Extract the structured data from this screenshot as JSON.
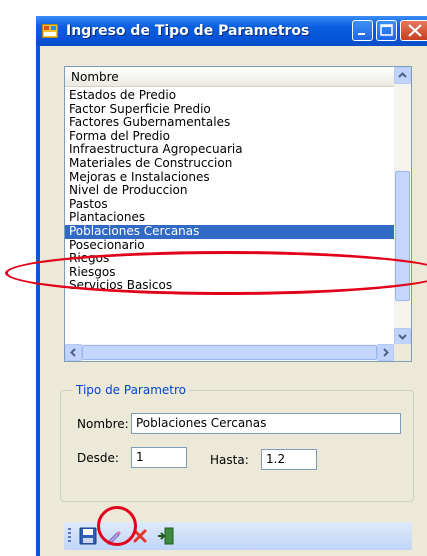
{
  "window": {
    "title": "Ingreso de Tipo de Parametros",
    "icons": {
      "app": "app-window-icon",
      "minimize": "minimize-icon",
      "maximize": "maximize-icon",
      "close": "close-icon"
    }
  },
  "list": {
    "header": "Nombre",
    "items": [
      "Estados de Predio",
      "Factor Superficie Predio",
      "Factores Gubernamentales",
      "Forma del Predio",
      "Infraestructura Agropecuaria",
      "Materiales de Construccion",
      "Mejoras e Instalaciones",
      "Nivel de Produccion",
      "Pastos",
      "Plantaciones",
      "Poblaciones Cercanas",
      "Posecionario",
      "Riegos",
      "Riesgos",
      "Servicios Basicos"
    ],
    "selected_index": 10
  },
  "group": {
    "title": "Tipo de Parametro",
    "nombre_label": "Nombre:",
    "nombre_value": "Poblaciones Cercanas",
    "desde_label": "Desde:",
    "desde_value": "1",
    "hasta_label": "Hasta:",
    "hasta_value": "1.2"
  },
  "toolbar": {
    "icons": [
      "save-icon",
      "edit-pencil-icon",
      "delete-x-icon",
      "exit-door-icon"
    ]
  },
  "colors": {
    "titlebar": "#0a5fe0",
    "selection": "#316ac5",
    "annotation": "#e3001b",
    "group_label": "#0046d5"
  }
}
